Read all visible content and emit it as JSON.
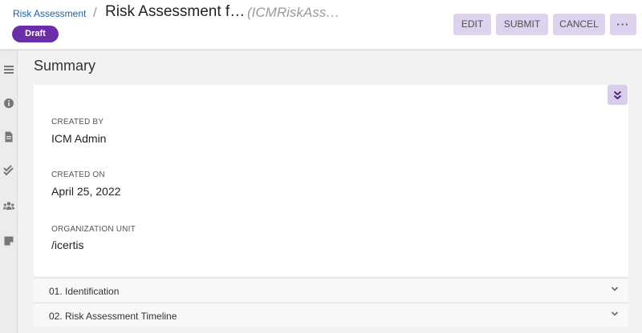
{
  "header": {
    "breadcrumb_link": "Risk Assessment",
    "breadcrumb_sep": "/",
    "title": "Risk Assessment f…",
    "subtitle": "(ICMRiskAss…",
    "status": "Draft",
    "buttons": {
      "edit": "EDIT",
      "submit": "SUBMIT",
      "cancel": "CANCEL",
      "more": "···"
    }
  },
  "sidebar": {
    "icons": [
      "menu-icon",
      "info-icon",
      "document-icon",
      "double-check-icon",
      "people-icon",
      "notes-icon"
    ]
  },
  "summary": {
    "title": "Summary",
    "fields": [
      {
        "label": "CREATED BY",
        "value": "ICM Admin"
      },
      {
        "label": "CREATED ON",
        "value": "April 25, 2022"
      },
      {
        "label": "ORGANIZATION UNIT",
        "value": "/icertis"
      }
    ]
  },
  "accordion": [
    {
      "label": "01. Identification"
    },
    {
      "label": "02. Risk Assessment Timeline"
    }
  ],
  "colors": {
    "accent": "#6a2fa8",
    "button_bg": "#ddd3ee",
    "link": "#1a5fb4"
  }
}
